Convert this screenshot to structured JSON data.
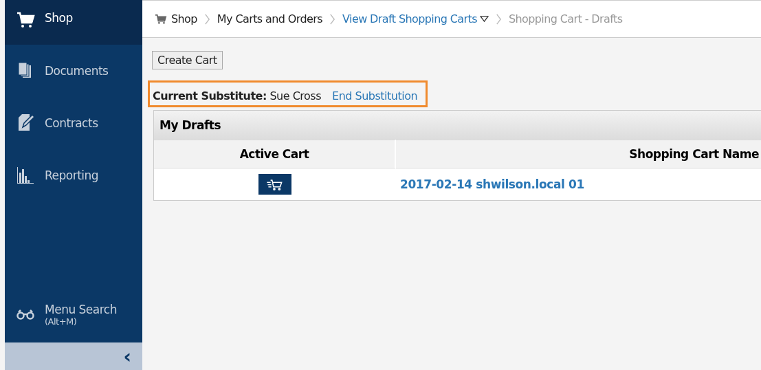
{
  "sidebar": {
    "items": [
      {
        "label": "Shop",
        "kind": "cart",
        "selected": true
      },
      {
        "label": "Documents",
        "kind": "documents",
        "selected": false
      },
      {
        "label": "Contracts",
        "kind": "contract",
        "selected": false
      },
      {
        "label": "Reporting",
        "kind": "chart",
        "selected": false
      }
    ],
    "menu_search": {
      "label": "Menu Search",
      "shortcut": "(Alt+M)"
    },
    "collapse": "‹"
  },
  "breadcrumb": [
    {
      "label": "Shop",
      "kind": "text",
      "dropdown": false
    },
    {
      "label": "My Carts and Orders",
      "kind": "text",
      "dropdown": false
    },
    {
      "label": "View Draft Shopping Carts",
      "kind": "link",
      "dropdown": true
    },
    {
      "label": "Shopping Cart - Drafts",
      "kind": "current",
      "dropdown": false
    }
  ],
  "create_button": "Create Cart",
  "substitute": {
    "label": "Current Substitute:",
    "name": "Sue Cross",
    "link": "End Substitution"
  },
  "drafts": {
    "title": "My Drafts",
    "columns": [
      "Active Cart",
      "Shopping Cart Name"
    ],
    "rows": [
      {
        "active": true,
        "name": "2017-02-14 shwilson.local 01"
      }
    ]
  }
}
